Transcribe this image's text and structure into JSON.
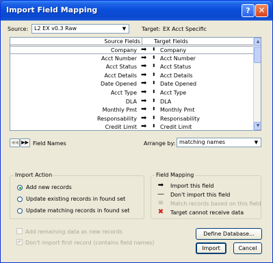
{
  "window": {
    "title": "Import Field Mapping",
    "help": "?",
    "close": "✕"
  },
  "source": {
    "label": "Source:",
    "value": "L2 EX v0.3 Raw"
  },
  "target": {
    "label": "Target:",
    "value": "EX Acct Specific"
  },
  "list": {
    "header_source": "Source Fields",
    "header_target": "Target Fields",
    "rows": [
      {
        "source": "Company",
        "target": "Company"
      },
      {
        "source": "Acct Number",
        "target": "Acct Number"
      },
      {
        "source": "Acct Status",
        "target": "Acct Status"
      },
      {
        "source": "Acct Details",
        "target": "Acct Details"
      },
      {
        "source": "Date Opened",
        "target": "Date Opened"
      },
      {
        "source": "Acct Type",
        "target": "Acct Type"
      },
      {
        "source": "DLA",
        "target": "DLA"
      },
      {
        "source": "Monthly Pmt",
        "target": "Monthly Pmt"
      },
      {
        "source": "Responsability",
        "target": "Responsability"
      },
      {
        "source": "Credit Limit",
        "target": "Credit Limit"
      }
    ],
    "arrow_glyph": "➡",
    "updown_glyph": "⬍"
  },
  "nav": {
    "prev": "◀◀",
    "next": "▶▶",
    "label": "Field Names"
  },
  "arrange": {
    "label": "Arrange by:",
    "value": "matching names"
  },
  "import_action": {
    "title": "Import Action",
    "options": [
      {
        "label": "Add new records",
        "selected": true
      },
      {
        "label": "Update existing records in found set",
        "selected": false
      },
      {
        "label": "Update matching records in found set",
        "selected": false
      }
    ]
  },
  "field_mapping": {
    "title": "Field Mapping",
    "items": [
      {
        "icon": "arrow-right-icon",
        "glyph": "➡",
        "label": "Import this field",
        "disabled": false,
        "color": "#000000"
      },
      {
        "icon": "dash-icon",
        "glyph": "—",
        "label": "Don't import this field",
        "disabled": false,
        "color": "#000000"
      },
      {
        "icon": "equals-icon",
        "glyph": "≡",
        "label": "Match records based on this field",
        "disabled": true,
        "color": "#aca899"
      },
      {
        "icon": "x-icon",
        "glyph": "✖",
        "label": "Target cannot receive data",
        "disabled": false,
        "color": "#d02020"
      }
    ]
  },
  "options": {
    "add_remaining": "Add remaining data as new records",
    "dont_import_first": "Don't import first record (contains field names)",
    "dont_import_first_checked": true
  },
  "buttons": {
    "define_database": "Define Database...",
    "import": "Import",
    "cancel": "Cancel"
  }
}
